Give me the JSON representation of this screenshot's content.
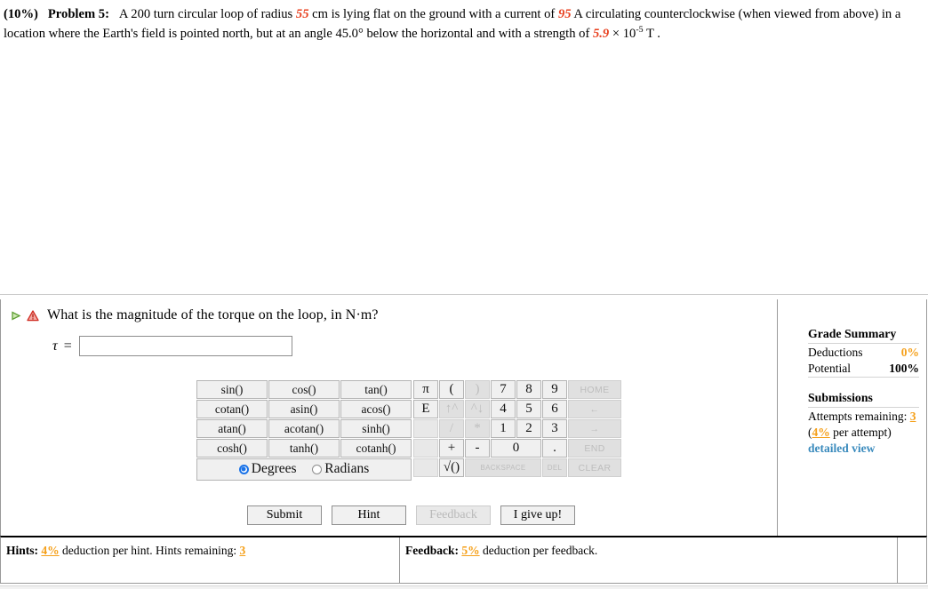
{
  "problem": {
    "weight": "(10%)",
    "label": "Problem 5:",
    "seg1": "A 200 turn circular loop of radius ",
    "radius": "55",
    "seg2": " cm is lying flat on the ground with a current of ",
    "current": "95",
    "seg3": " A circulating counterclockwise (when viewed from above) in a location where the Earth's field is pointed north, but at an angle 45.0° below the horizontal and with a strength of ",
    "field": "5.9",
    "seg4": " × 10",
    "field_exp": "-5",
    "seg5": " T ."
  },
  "question": {
    "play_icon": "play-triangle-icon",
    "warning_icon": "warning-triangle-icon",
    "text": "What is the magnitude of the torque on the loop, in N·m?",
    "variable": "τ",
    "equals": "=",
    "answer_value": "",
    "answer_placeholder": ""
  },
  "calculator": {
    "function_rows": [
      [
        "sin()",
        "cos()",
        "tan()"
      ],
      [
        "cotan()",
        "asin()",
        "acos()"
      ],
      [
        "atan()",
        "acotan()",
        "sinh()"
      ],
      [
        "cosh()",
        "tanh()",
        "cotanh()"
      ]
    ],
    "mode": {
      "degrees_label": "Degrees",
      "radians_label": "Radians",
      "selected": "Degrees"
    },
    "keypad_rows": [
      [
        {
          "label": "π",
          "kind": "sym",
          "disabled": false
        },
        {
          "label": "(",
          "kind": "sym",
          "disabled": false
        },
        {
          "label": ")",
          "kind": "sym",
          "disabled": true
        },
        {
          "label": "7",
          "kind": "num",
          "disabled": false
        },
        {
          "label": "8",
          "kind": "num",
          "disabled": false
        },
        {
          "label": "9",
          "kind": "num",
          "disabled": false
        },
        {
          "label": "HOME",
          "kind": "nav",
          "disabled": true
        }
      ],
      [
        {
          "label": "E",
          "kind": "sym",
          "disabled": false
        },
        {
          "label": "↑^",
          "kind": "sym",
          "disabled": true
        },
        {
          "label": "^↓",
          "kind": "sym",
          "disabled": true
        },
        {
          "label": "4",
          "kind": "num",
          "disabled": false
        },
        {
          "label": "5",
          "kind": "num",
          "disabled": false
        },
        {
          "label": "6",
          "kind": "num",
          "disabled": false
        },
        {
          "label": "←",
          "kind": "nav",
          "disabled": true
        }
      ],
      [
        {
          "label": "",
          "kind": "blank",
          "disabled": true
        },
        {
          "label": "/",
          "kind": "sym",
          "disabled": true
        },
        {
          "label": "*",
          "kind": "sym",
          "disabled": true
        },
        {
          "label": "1",
          "kind": "num",
          "disabled": false
        },
        {
          "label": "2",
          "kind": "num",
          "disabled": false
        },
        {
          "label": "3",
          "kind": "num",
          "disabled": false
        },
        {
          "label": "→",
          "kind": "nav",
          "disabled": true
        }
      ],
      [
        {
          "label": "",
          "kind": "blank",
          "disabled": true
        },
        {
          "label": "+",
          "kind": "sym",
          "disabled": false
        },
        {
          "label": "-",
          "kind": "sym",
          "disabled": false
        },
        {
          "label": "0",
          "kind": "num",
          "disabled": false,
          "colspan": 2
        },
        {
          "label": ".",
          "kind": "sym",
          "disabled": false
        },
        {
          "label": "END",
          "kind": "nav",
          "disabled": true
        }
      ],
      [
        {
          "label": "",
          "kind": "blank",
          "disabled": true
        },
        {
          "label": "√()",
          "kind": "sym",
          "disabled": false
        },
        {
          "label": "BACKSPACE",
          "kind": "tiny",
          "disabled": true,
          "colspan": 3
        },
        {
          "label": "DEL",
          "kind": "tiny",
          "disabled": true
        },
        {
          "label": "CLEAR",
          "kind": "nav",
          "disabled": true
        }
      ]
    ]
  },
  "actions": {
    "submit": "Submit",
    "hint": "Hint",
    "feedback": "Feedback",
    "give_up": "I give up!"
  },
  "grade_summary": {
    "title": "Grade Summary",
    "deductions_label": "Deductions",
    "deductions_value": "0%",
    "potential_label": "Potential",
    "potential_value": "100%",
    "submissions_title": "Submissions",
    "attempts_label": "Attempts remaining:",
    "attempts_value": "3",
    "per_attempt_open": "(",
    "per_attempt_value": "4%",
    "per_attempt_rest": " per attempt)",
    "detailed_view": "detailed view"
  },
  "bottom_bar": {
    "hints_label": "Hints:",
    "hints_pct": "4%",
    "hints_text": " deduction per hint. Hints remaining:",
    "hints_remaining": "3",
    "feedback_label": "Feedback:",
    "feedback_pct": "5%",
    "feedback_text": " deduction per feedback."
  },
  "colors": {
    "highlight": "#e8401f",
    "orange": "#f5a01a",
    "link_blue": "#3b8bbd",
    "radio_blue": "#1a73e8"
  }
}
